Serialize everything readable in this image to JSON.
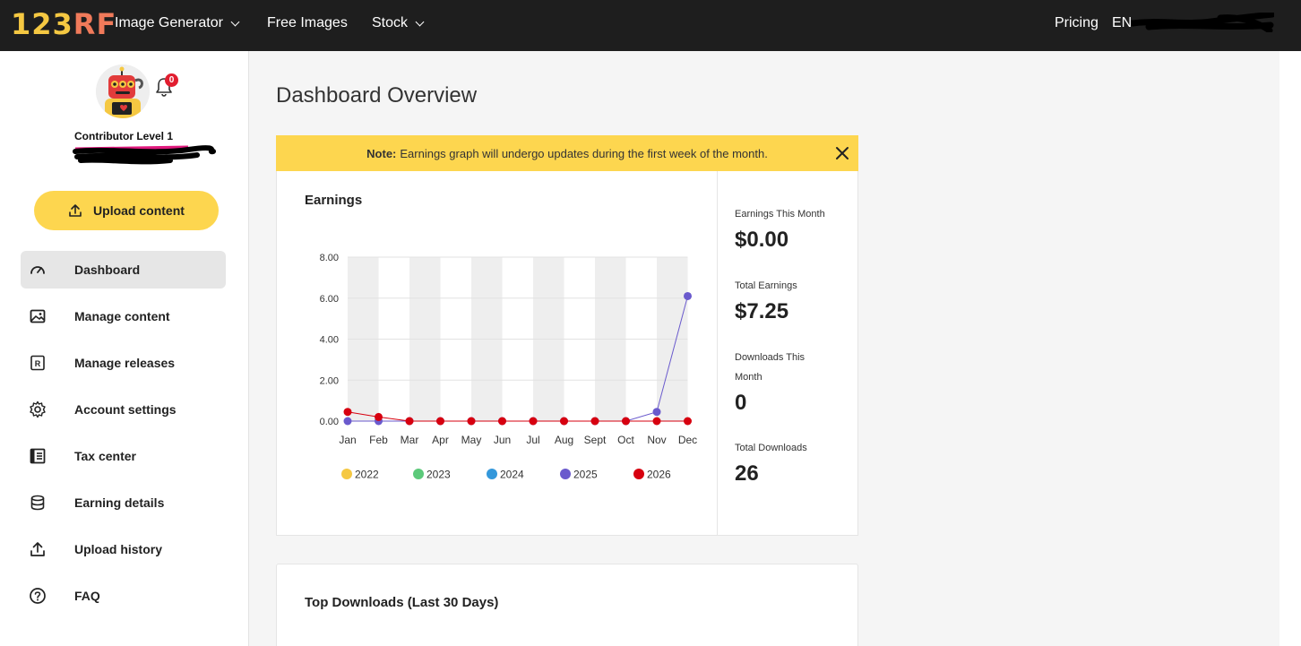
{
  "topbar": {
    "logo_part1": "123",
    "logo_part2": "RF",
    "nav": [
      {
        "label": "Image Generator",
        "has_dropdown": true
      },
      {
        "label": "Free Images",
        "has_dropdown": false
      },
      {
        "label": "Stock",
        "has_dropdown": true
      }
    ],
    "pricing": "Pricing",
    "language": "EN"
  },
  "sidebar": {
    "notification_count": "0",
    "contributor_level": "Contributor Level 1",
    "upload_button": "Upload content",
    "menu": [
      {
        "label": "Dashboard",
        "icon": "gauge-icon",
        "active": true
      },
      {
        "label": "Manage content",
        "icon": "image-icon",
        "active": false
      },
      {
        "label": "Manage releases",
        "icon": "release-icon",
        "active": false
      },
      {
        "label": "Account settings",
        "icon": "gear-icon",
        "active": false
      },
      {
        "label": "Tax center",
        "icon": "ledger-icon",
        "active": false
      },
      {
        "label": "Earning details",
        "icon": "coins-icon",
        "active": false
      },
      {
        "label": "Upload history",
        "icon": "upload-icon",
        "active": false
      },
      {
        "label": "FAQ",
        "icon": "help-icon",
        "active": false
      }
    ]
  },
  "main": {
    "title": "Dashboard Overview",
    "note_label": "Note:",
    "note_text": "Earnings graph will undergo updates during the first week of the month.",
    "earnings_title": "Earnings",
    "stats": [
      {
        "label": "Earnings This Month",
        "value": "$0.00"
      },
      {
        "label": "Total Earnings",
        "value": "$7.25"
      },
      {
        "label": "Downloads This Month",
        "value": "0"
      },
      {
        "label": "Total Downloads",
        "value": "26"
      }
    ],
    "top_downloads_title": "Top Downloads (Last 30 Days)"
  },
  "chart_data": {
    "type": "line",
    "title": "Earnings",
    "categories": [
      "Jan",
      "Feb",
      "Mar",
      "Apr",
      "May",
      "Jun",
      "Jul",
      "Aug",
      "Sept",
      "Oct",
      "Nov",
      "Dec"
    ],
    "ylim": [
      0,
      8
    ],
    "yticks": [
      "0.00",
      "2.00",
      "4.00",
      "6.00",
      "8.00"
    ],
    "legend_position": "bottom",
    "series": [
      {
        "name": "2022",
        "color": "#f5c842",
        "values": null
      },
      {
        "name": "2023",
        "color": "#5cc97a",
        "values": null
      },
      {
        "name": "2024",
        "color": "#3498db",
        "values": null
      },
      {
        "name": "2025",
        "color": "#6a5acd",
        "values": [
          0,
          0,
          0,
          0,
          0,
          0,
          0,
          0,
          0,
          0,
          0.45,
          6.1
        ]
      },
      {
        "name": "2026",
        "color": "#d7000f",
        "values": [
          0.45,
          0.2,
          0,
          0,
          0,
          0,
          0,
          0,
          0,
          0,
          0,
          0
        ]
      }
    ]
  }
}
